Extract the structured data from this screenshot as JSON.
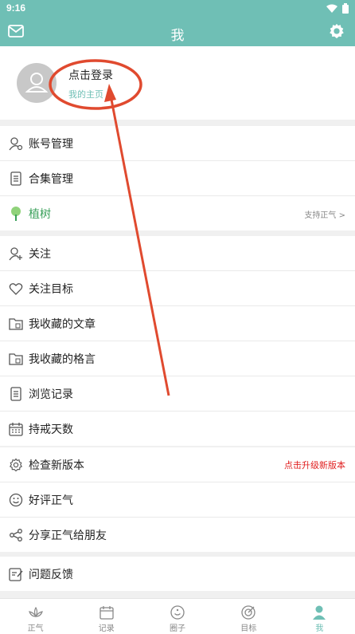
{
  "status_bar": {
    "time": "9:16"
  },
  "header": {
    "title": "我"
  },
  "profile": {
    "login_text": "点击登录",
    "homepage_text": "我的主页"
  },
  "group1": [
    {
      "label": "账号管理"
    },
    {
      "label": "合集管理"
    },
    {
      "label": "植树",
      "right": "支持正气 >"
    }
  ],
  "group2": [
    {
      "label": "关注"
    },
    {
      "label": "关注目标"
    },
    {
      "label": "我收藏的文章"
    },
    {
      "label": "我收藏的格言"
    },
    {
      "label": "浏览记录"
    },
    {
      "label": "持戒天数"
    }
  ],
  "group3": [
    {
      "label": "检查新版本",
      "right": "点击升级新版本"
    },
    {
      "label": "好评正气"
    },
    {
      "label": "分享正气给朋友"
    }
  ],
  "group4": [
    {
      "label": "问题反馈"
    }
  ],
  "tabbar": [
    {
      "label": "正气"
    },
    {
      "label": "记录"
    },
    {
      "label": "圈子"
    },
    {
      "label": "目标"
    },
    {
      "label": "我"
    }
  ],
  "colors": {
    "accent": "#6fbfb5",
    "annotation": "#e04a2f",
    "upgrade_text": "#e02020",
    "tree": "#3aa05a"
  }
}
